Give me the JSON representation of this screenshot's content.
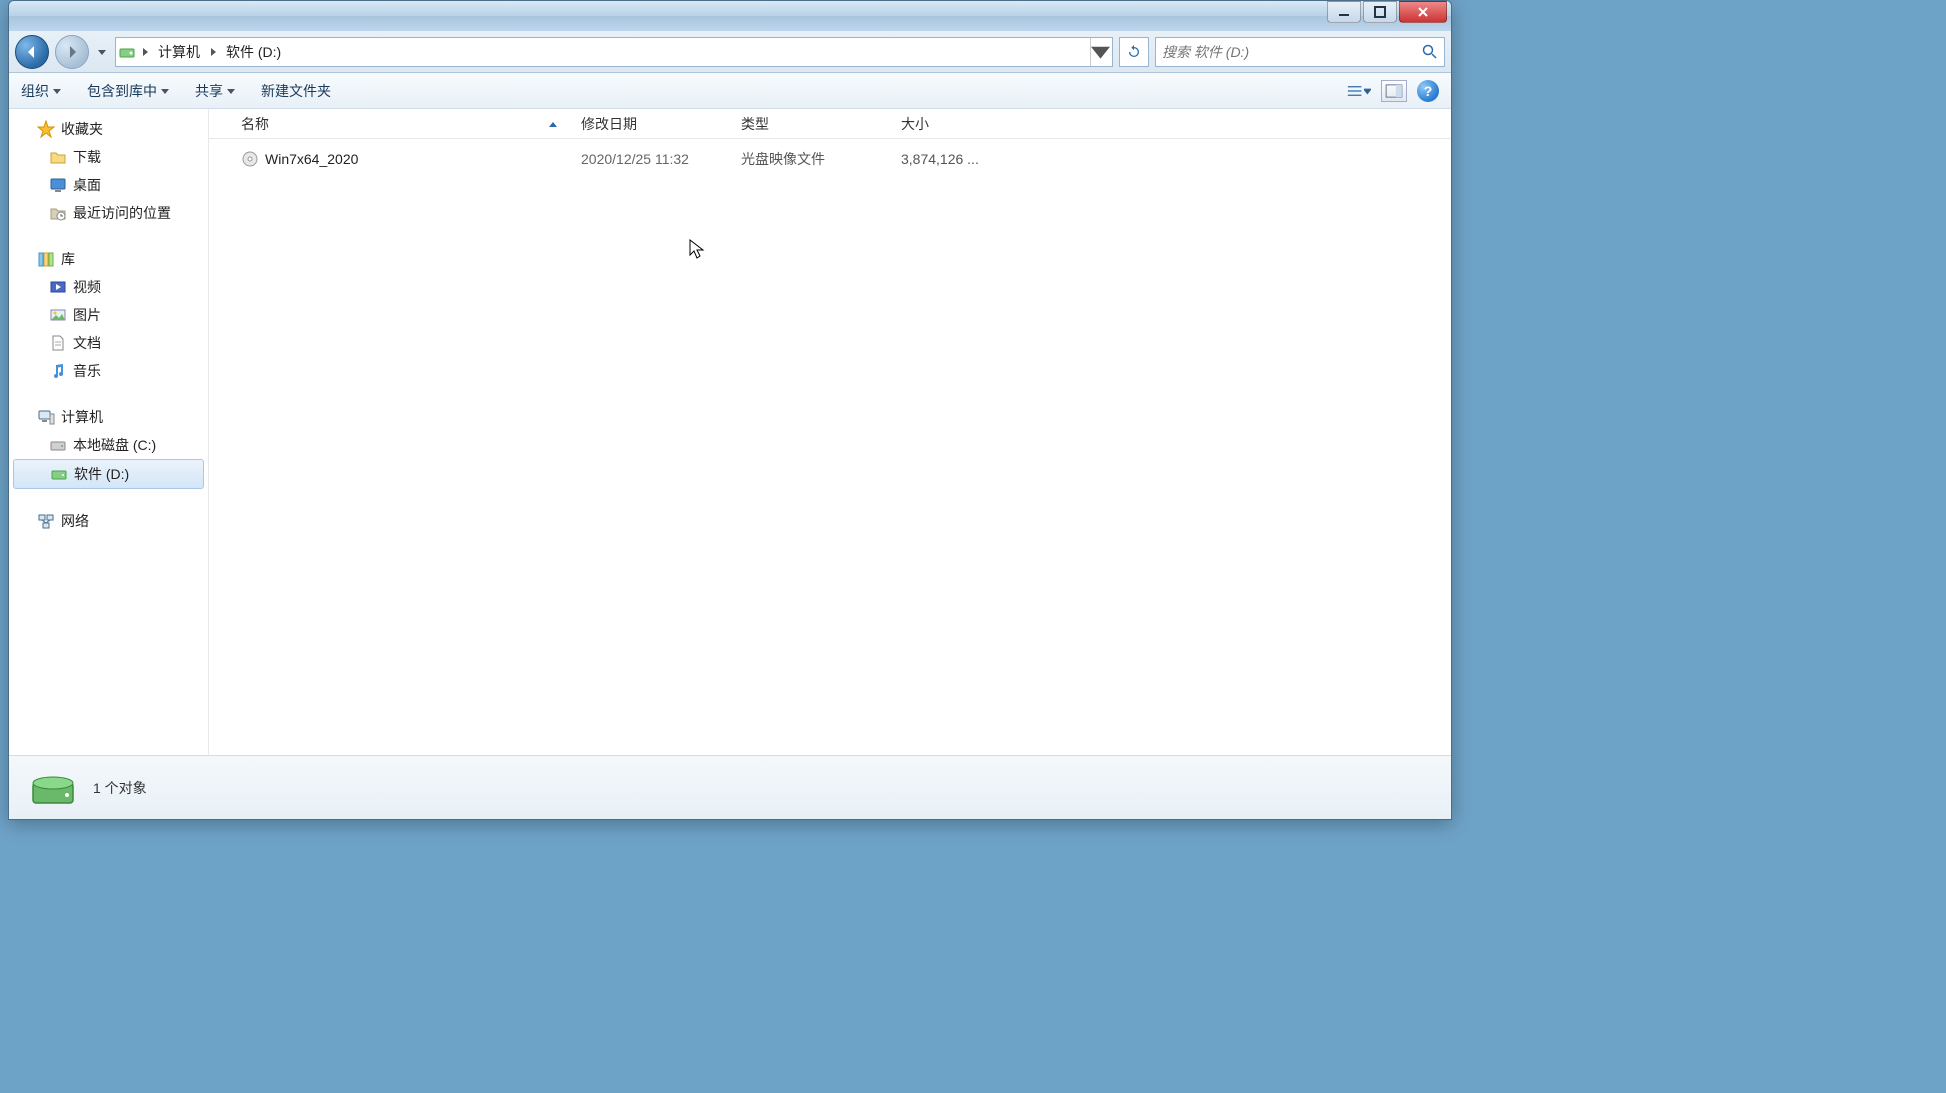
{
  "breadcrumb": {
    "parts": [
      "计算机",
      "软件 (D:)"
    ]
  },
  "search": {
    "placeholder": "搜索 软件 (D:)"
  },
  "toolbar": {
    "organize": "组织",
    "include": "包含到库中",
    "share": "共享",
    "newfolder": "新建文件夹"
  },
  "sidebar": {
    "favorites": {
      "label": "收藏夹",
      "items": [
        "下载",
        "桌面",
        "最近访问的位置"
      ]
    },
    "libraries": {
      "label": "库",
      "items": [
        "视频",
        "图片",
        "文档",
        "音乐"
      ]
    },
    "computer": {
      "label": "计算机",
      "items": [
        "本地磁盘 (C:)",
        "软件 (D:)"
      ]
    },
    "network": {
      "label": "网络"
    }
  },
  "columns": {
    "name": "名称",
    "date": "修改日期",
    "type": "类型",
    "size": "大小"
  },
  "files": [
    {
      "name": "Win7x64_2020",
      "date": "2020/12/25 11:32",
      "type": "光盘映像文件",
      "size": "3,874,126 ..."
    }
  ],
  "status": {
    "count": "1 个对象"
  }
}
